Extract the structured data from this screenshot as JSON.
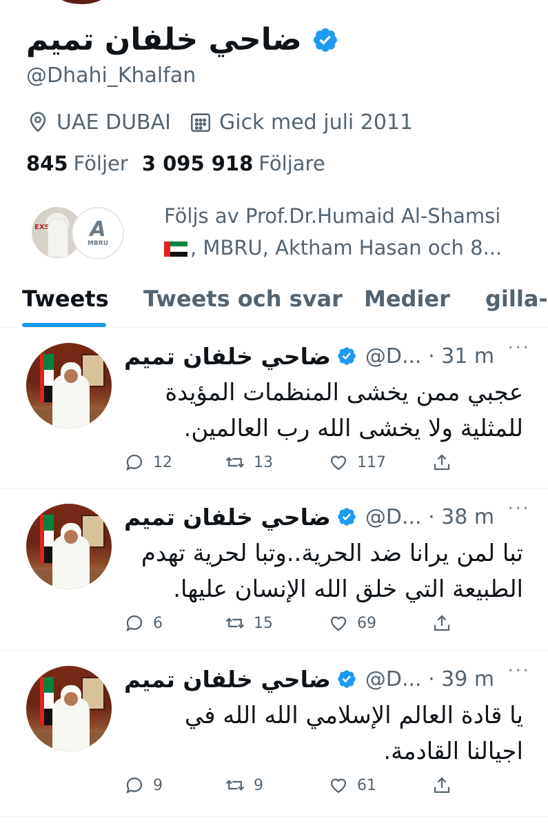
{
  "profile": {
    "display_name": "ضاحي خلفان تميم",
    "handle": "@Dhahi_Khalfan",
    "location": "UAE DUBAI",
    "joined": "Gick med juli 2011",
    "following_count": "845",
    "following_label": "Följer",
    "followers_count": "3 095 918",
    "followers_label": "Följare",
    "followed_by_line1": "Följs av Prof.Dr.Humaid Al-Shamsi",
    "followed_by_line2": ", MBRU, Aktham Hasan och 8...",
    "mini_avatar_badge": "EXS",
    "mini_logo_mark": "A",
    "mini_logo_text": "MBRU"
  },
  "tabs": [
    {
      "label": "Tweets",
      "active": true
    },
    {
      "label": "Tweets och svar",
      "active": false
    },
    {
      "label": "Medier",
      "active": false
    },
    {
      "label": "gilla-r",
      "active": false
    }
  ],
  "more_label": "···",
  "tweets": [
    {
      "name": "ضاحي خلفان تميم",
      "handle_time": "@D... · 31 m",
      "text": "عجبي ممن يخشى المنظمات المؤيدة للمثلية ولا يخشى الله رب العالمين.",
      "replies": "12",
      "retweets": "13",
      "likes": "117"
    },
    {
      "name": "ضاحي خلفان تميم",
      "handle_time": "@D... · 38 m",
      "text": "تبا لمن يرانا ضد الحرية..وتبا لحرية تهدم الطبيعة التي خلق الله الإنسان عليها.",
      "replies": "6",
      "retweets": "15",
      "likes": "69"
    },
    {
      "name": "ضاحي خلفان تميم",
      "handle_time": "@D... · 39 m",
      "text": "يا قادة العالم الإسلامي الله الله في اجيالنا القادمة.",
      "replies": "9",
      "retweets": "9",
      "likes": "61"
    }
  ],
  "colors": {
    "accent": "#1d9bf0",
    "text": "#0f1419",
    "muted": "#536471",
    "divider": "#eff3f4"
  }
}
